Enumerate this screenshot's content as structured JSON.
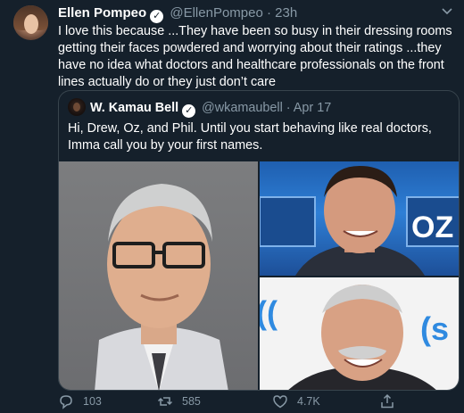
{
  "tweet": {
    "author_name": "Ellen Pompeo",
    "handle": "@EllenPompeo",
    "separator": "·",
    "time": "23h",
    "text": "I love this because ...They have been so busy in their dressing rooms getting their faces powdered and worrying about their ratings ...they have no idea what doctors and healthcare professionals on the front lines actually do or they just don’t care",
    "verified_glyph": "✓"
  },
  "quoted": {
    "author_name": "W. Kamau Bell",
    "handle": "@wkamaubell",
    "separator": "·",
    "date": "Apr 17",
    "text": "Hi, Drew, Oz, and Phil. Until you start behaving like real doctors, Imma call you by your first names.",
    "verified_glyph": "✓",
    "photo_oz_sign_text": "OZ",
    "photo_phil_sign_text": "(("
  },
  "actions": {
    "reply_count": "103",
    "retweet_count": "585",
    "like_count": "4.7K"
  },
  "colors": {
    "background": "#15202b",
    "text": "#ffffff",
    "muted": "#8899a6",
    "border": "#38444d"
  },
  "icons": [
    "chevron-down-icon",
    "verified-badge-icon",
    "reply-icon",
    "retweet-icon",
    "like-icon",
    "share-icon"
  ]
}
